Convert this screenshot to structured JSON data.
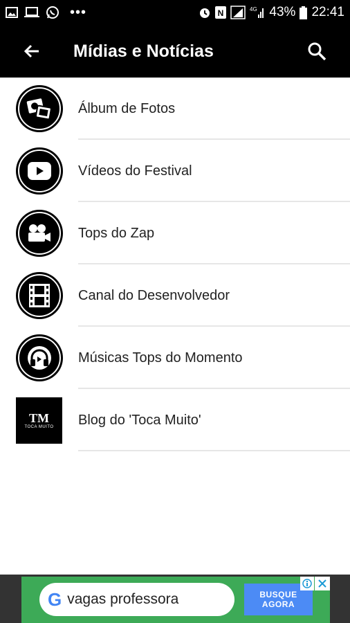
{
  "status_bar": {
    "battery_text": "43%",
    "time": "22:41",
    "network": "4G",
    "left_icons": [
      "image-icon",
      "laptop-icon",
      "whatsapp-icon"
    ],
    "right_icons": [
      "alarm-icon",
      "nfc-icon",
      "signal-icon",
      "battery-icon"
    ]
  },
  "app_bar": {
    "title": "Mídias e Notícias",
    "back_icon": "back-arrow-icon",
    "search_icon": "search-icon",
    "background": "#000000"
  },
  "menu": {
    "items": [
      {
        "label": "Álbum de Fotos",
        "icon": "photos-icon"
      },
      {
        "label": "Vídeos do Festival",
        "icon": "youtube-icon"
      },
      {
        "label": "Tops do Zap",
        "icon": "video-camera-icon"
      },
      {
        "label": "Canal do Desenvolvedor",
        "icon": "film-strip-icon"
      },
      {
        "label": "Músicas Tops do Momento",
        "icon": "headphones-icon"
      },
      {
        "label": "Blog do 'Toca Muito'",
        "icon": "toca-muito-logo"
      }
    ]
  },
  "logo": {
    "text": "TM",
    "sub": "TOCA MUITO"
  },
  "ad": {
    "query": "vagas professora",
    "button_label": "BUSQUE AGORA",
    "google_letter": "G",
    "background": "#3daa57",
    "button_color": "#4c8bf5"
  }
}
